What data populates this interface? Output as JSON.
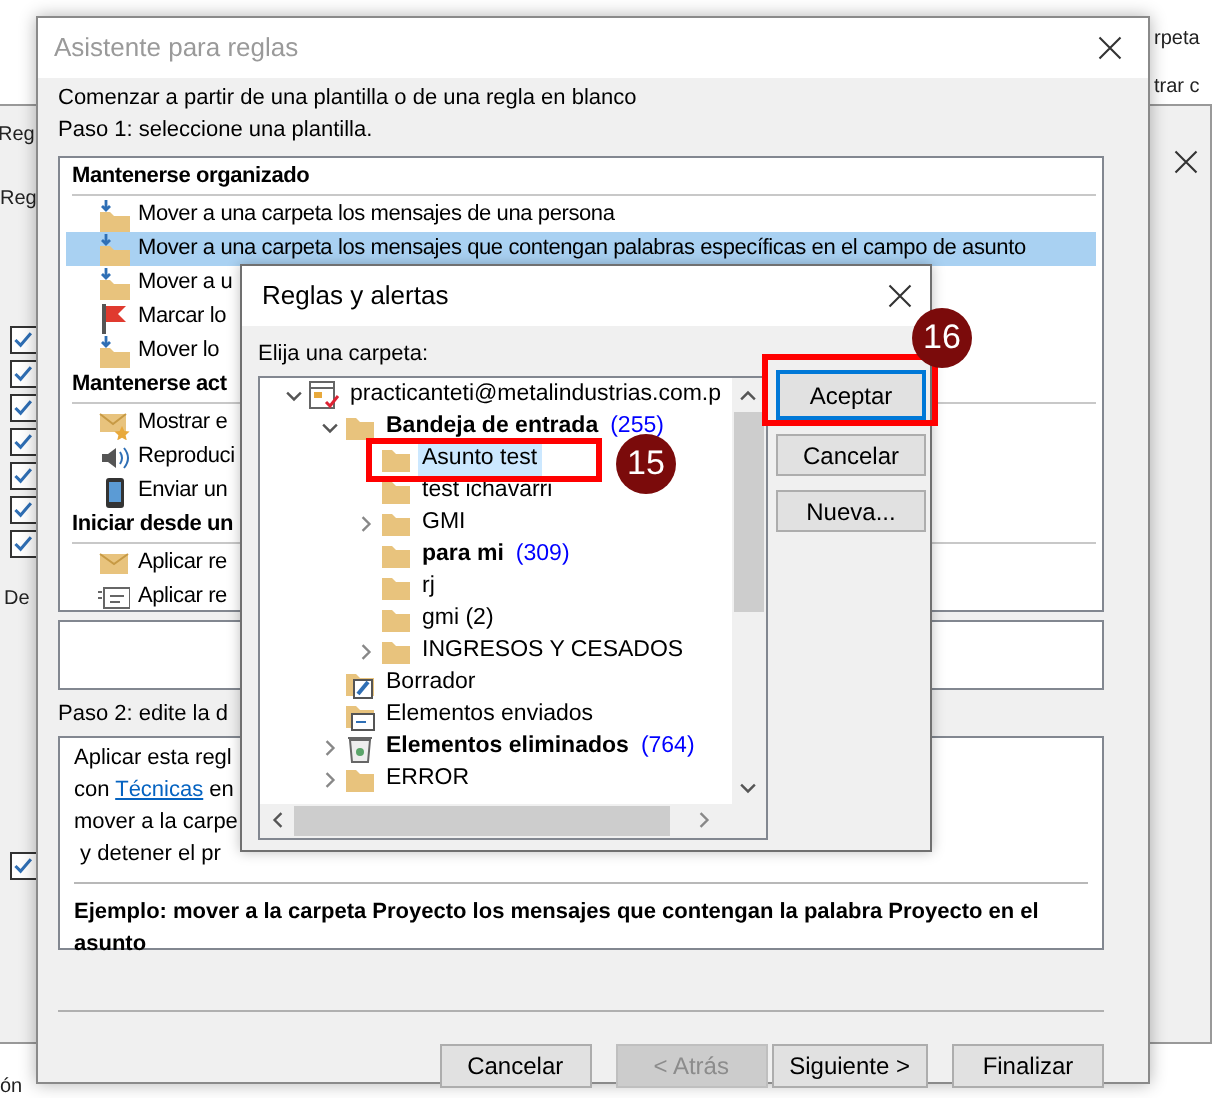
{
  "background": {
    "fragments": [
      "Reg",
      "Reg",
      "De",
      "ón",
      "rpeta",
      "trar c"
    ],
    "checkboxes": [
      {
        "checked": true
      },
      {
        "checked": true
      },
      {
        "checked": true
      },
      {
        "checked": true
      },
      {
        "checked": true
      },
      {
        "checked": true
      },
      {
        "checked": true
      },
      {
        "checked": true
      }
    ]
  },
  "wizard": {
    "title": "Asistente para reglas",
    "intro": "Comenzar a partir de una plantilla o de una regla en blanco",
    "step1": "Paso 1: seleccione una plantilla.",
    "templates": [
      {
        "header": "Mantenerse organizado",
        "items": [
          {
            "label": "Mover a una carpeta los mensajes de una persona",
            "kind": "move",
            "selected": false
          },
          {
            "label": "Mover a una carpeta los mensajes que contengan palabras específicas en el campo de asunto",
            "kind": "move",
            "selected": true
          },
          {
            "label": "Mover a u",
            "kind": "move",
            "selected": false
          },
          {
            "label": "Marcar lo",
            "kind": "flag",
            "selected": false
          },
          {
            "label": "Mover lo",
            "kind": "move",
            "selected": false
          }
        ]
      },
      {
        "header": "Mantenerse act",
        "items": [
          {
            "label": "Mostrar e",
            "kind": "star-mail",
            "selected": false
          },
          {
            "label": "Reproduci",
            "kind": "speaker",
            "selected": false
          },
          {
            "label": "Enviar un",
            "kind": "phone",
            "selected": false
          }
        ]
      },
      {
        "header": "Iniciar desde un",
        "items": [
          {
            "label": "Aplicar re",
            "kind": "envelope",
            "selected": false
          },
          {
            "label": "Aplicar re",
            "kind": "card",
            "selected": false
          }
        ]
      }
    ],
    "step2": "Paso 2: edite la d",
    "description": [
      {
        "text": "Aplicar esta regl"
      },
      {
        "text": "con ",
        "link": "Técnicas",
        "after": " en"
      },
      {
        "text": "mover a la carpe"
      },
      {
        "text": " y detener el pr"
      }
    ],
    "example": "Ejemplo: mover a la carpeta Proyecto los mensajes que contengan la palabra Proyecto en el asunto",
    "buttons": [
      {
        "label": "Cancelar",
        "disabled": false
      },
      {
        "label": "< Atrás",
        "disabled": true
      },
      {
        "label": "Siguiente >",
        "disabled": false
      },
      {
        "label": "Finalizar",
        "disabled": false
      }
    ]
  },
  "folder_dialog": {
    "title": "Reglas y alertas",
    "prompt": "Elija una carpeta:",
    "tree": [
      {
        "label": "practicanteti@metalindustrias.com.p",
        "kind": "account",
        "bold": false,
        "selected": false,
        "expanded": true,
        "children": [
          {
            "label": "Bandeja de entrada",
            "count": "(255)",
            "kind": "folder",
            "bold": true,
            "selected": false,
            "expanded": true,
            "children": [
              {
                "label": "Asunto test",
                "kind": "folder",
                "bold": false,
                "selected": true
              },
              {
                "label": "test ichavarri",
                "kind": "folder",
                "bold": false,
                "selected": false
              },
              {
                "label": "GMI",
                "kind": "folder",
                "bold": false,
                "selected": false,
                "expanded": false
              },
              {
                "label": "para mi",
                "count": "(309)",
                "kind": "folder",
                "bold": true,
                "selected": false
              },
              {
                "label": "rj",
                "kind": "folder",
                "bold": false,
                "selected": false
              },
              {
                "label": "gmi (2)",
                "kind": "folder",
                "bold": false,
                "selected": false
              },
              {
                "label": "INGRESOS Y CESADOS",
                "kind": "folder",
                "bold": false,
                "selected": false,
                "expanded": false
              }
            ]
          },
          {
            "label": "Borrador",
            "kind": "drafts",
            "bold": false,
            "selected": false
          },
          {
            "label": "Elementos enviados",
            "kind": "sent",
            "bold": false,
            "selected": false
          },
          {
            "label": "Elementos eliminados",
            "count": "(764)",
            "kind": "trash",
            "bold": true,
            "selected": false,
            "expanded": false
          },
          {
            "label": "ERROR",
            "kind": "folder",
            "bold": false,
            "selected": false,
            "expanded": false
          }
        ]
      }
    ],
    "buttons": [
      {
        "label": "Aceptar",
        "default": true
      },
      {
        "label": "Cancelar",
        "default": false
      },
      {
        "label": "Nueva...",
        "default": false
      }
    ]
  },
  "callouts": [
    {
      "label": "15"
    },
    {
      "label": "16"
    }
  ]
}
